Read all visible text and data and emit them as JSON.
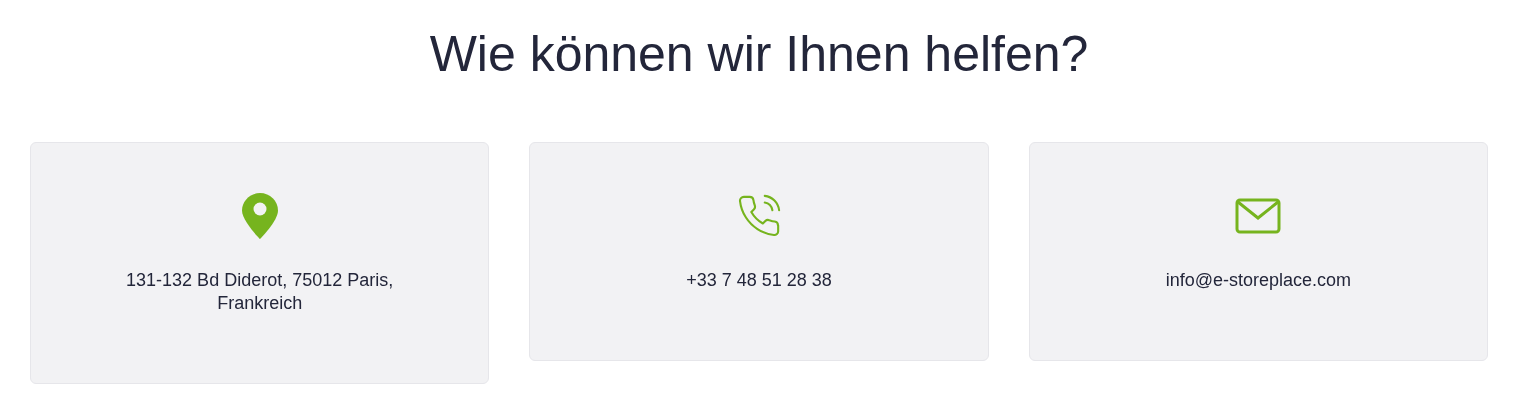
{
  "heading": "Wie können wir Ihnen helfen?",
  "cards": [
    {
      "kind": "location",
      "text": "131-132 Bd Diderot, 75012 Paris, Frankreich"
    },
    {
      "kind": "phone",
      "text": "+33 7 48 51 28 38"
    },
    {
      "kind": "email",
      "text": "info@e-storeplace.com"
    }
  ]
}
